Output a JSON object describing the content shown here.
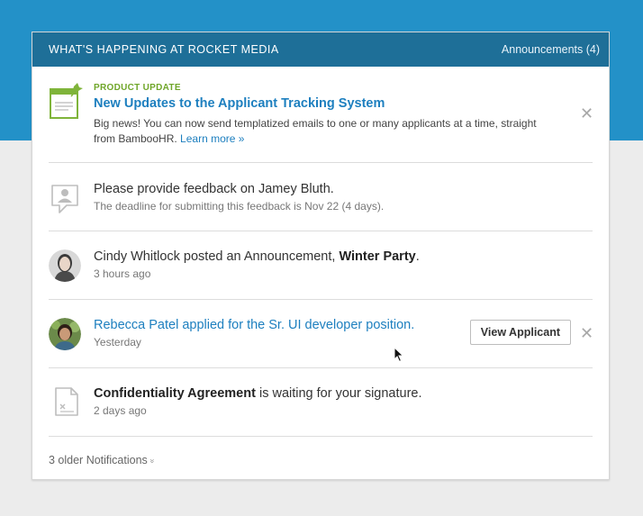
{
  "header": {
    "title": "WHAT'S HAPPENING AT ROCKET MEDIA",
    "announcements_link": "Announcements (4)"
  },
  "notifications": [
    {
      "icon": "announcement-pin-icon",
      "eyebrow": "PRODUCT UPDATE",
      "title": "New Updates to the Applicant Tracking System",
      "body": "Big news! You can now send templatized emails to one or many applicants at a time, straight from BambooHR.",
      "link": "Learn more »"
    },
    {
      "icon": "feedback-bubble-icon",
      "text": "Please provide feedback on Jamey Bluth.",
      "sub": "The deadline for submitting this feedback is Nov 22 (4 days)."
    },
    {
      "icon": "avatar-cindy",
      "text_prefix": "Cindy Whitlock posted an Announcement,",
      "text_bold": "Winter Party",
      "text_suffix": ".",
      "sub": "3 hours ago"
    },
    {
      "icon": "avatar-rebecca",
      "text": "Rebecca Patel applied for the Sr. UI developer position.",
      "sub": "Yesterday",
      "button": "View Applicant"
    },
    {
      "icon": "document-icon",
      "text_bold": "Confidentiality Agreement",
      "text_suffix": " is waiting for your signature.",
      "sub": "2 days ago"
    }
  ],
  "footer": {
    "older": "3 older Notifications",
    "chevron": "»"
  },
  "colors": {
    "brand_blue": "#2391c8",
    "header_blue": "#1e6f98",
    "link_blue": "#1d7fbf",
    "accent_green": "#6fa629"
  }
}
